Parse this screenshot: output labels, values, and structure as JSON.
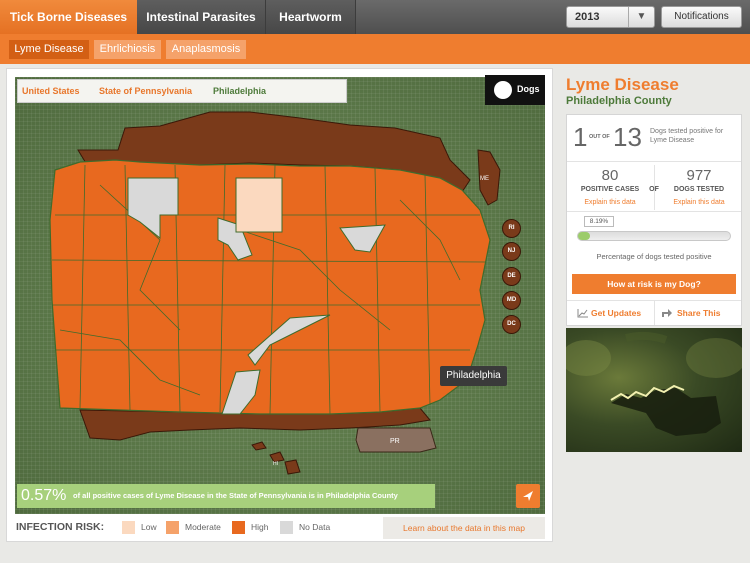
{
  "top_nav": {
    "tabs": [
      {
        "label": "Tick Borne Diseases",
        "active": true
      },
      {
        "label": "Intestinal Parasites",
        "active": false
      },
      {
        "label": "Heartworm",
        "active": false
      }
    ],
    "year": "2013",
    "notifications_label": "Notifications"
  },
  "sub_nav": {
    "tabs": [
      {
        "label": "Lyme Disease",
        "active": true
      },
      {
        "label": "Ehrlichiosis",
        "active": false
      },
      {
        "label": "Anaplasmosis",
        "active": false
      }
    ]
  },
  "breadcrumb": [
    "United States",
    "State of Pennsylvania",
    "Philadelphia"
  ],
  "species_toggle": "Dogs",
  "state_badges": [
    "RI",
    "NJ",
    "DE",
    "MD",
    "DC"
  ],
  "region_labels": {
    "me": "ME",
    "pr": "PR",
    "hi": "HI"
  },
  "tooltip": "Philadelphia",
  "info_bar": {
    "percent": "0.57%",
    "text": "of all positive cases of Lyme Disease in the State of Pennsylvania is in Philadelphia County"
  },
  "legend": {
    "title": "INFECTION RISK:",
    "items": [
      {
        "label": "Low",
        "color": "#fbd9bf"
      },
      {
        "label": "Moderate",
        "color": "#f5a26a"
      },
      {
        "label": "High",
        "color": "#e8691f"
      },
      {
        "label": "No Data",
        "color": "#d9d9d9"
      }
    ]
  },
  "learn_link": "Learn about the data in this map",
  "side": {
    "title": "Lyme Disease",
    "subtitle": "Philadelphia County",
    "ratio_num": "1",
    "ratio_out_of": "OUT OF",
    "ratio_den": "13",
    "ratio_text": "Dogs tested positive for Lyme Disease",
    "positive_cases": "80",
    "positive_label": "POSITIVE CASES",
    "of_label": "OF",
    "dogs_tested": "977",
    "dogs_tested_label": "DOGS TESTED",
    "explain1": "Explain this data",
    "explain2": "Explain this data",
    "percent_bubble": "8.19%",
    "percent_value": 8.19,
    "bar_caption": "Percentage of dogs tested positive",
    "risk_button": "How at risk is my Dog?",
    "updates_button": "Get Updates",
    "share_button": "Share This"
  },
  "colors": {
    "accent": "#ef7d2f",
    "green": "#4d7a3a",
    "high": "#e8691f",
    "dark_neighbor": "#7a3a1a"
  }
}
